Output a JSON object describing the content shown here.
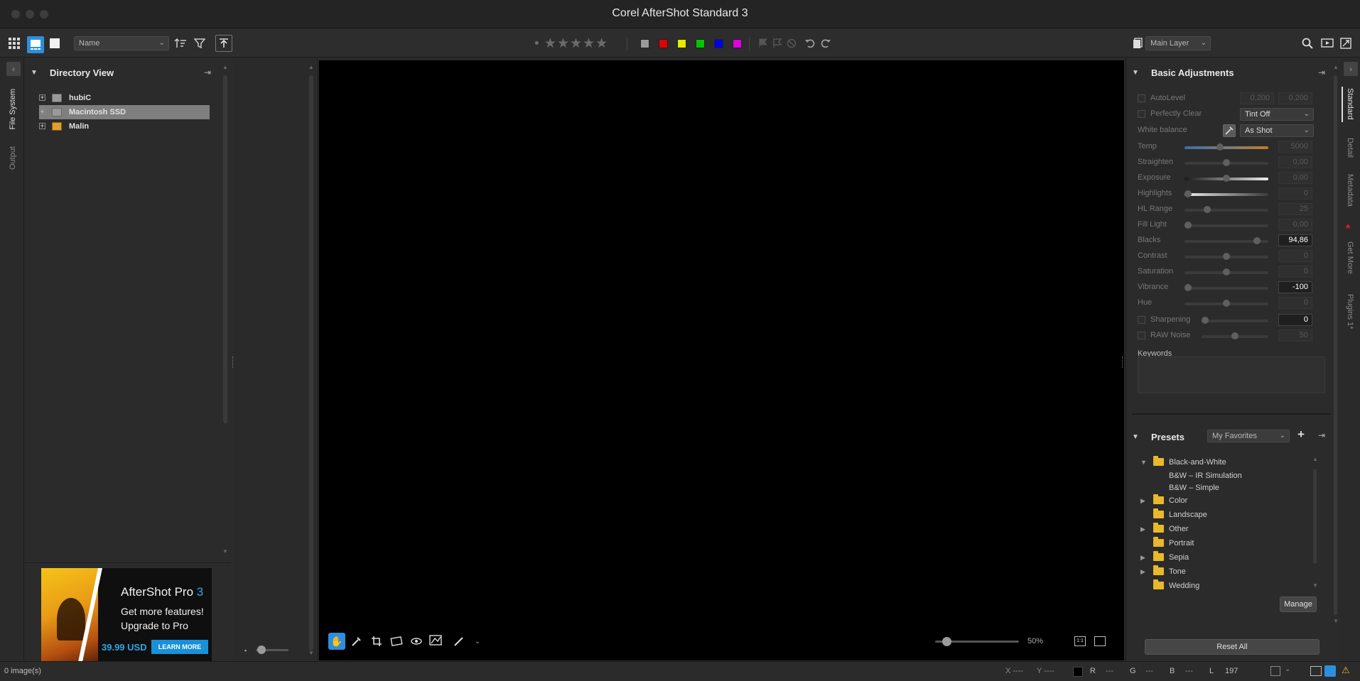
{
  "window": {
    "title": "Corel AfterShot Standard 3"
  },
  "toolbar": {
    "sort_select": "Name",
    "stars": "• ★★★★★",
    "colors": [
      "#9a9a9a",
      "#e00000",
      "#e8e800",
      "#00c800",
      "#0000e0",
      "#e000e0"
    ],
    "layer_select": "Main Layer"
  },
  "left_tabs": {
    "file_system": "File System",
    "output": "Output"
  },
  "directory": {
    "title": "Directory View",
    "items": [
      {
        "label": "hubiC"
      },
      {
        "label": "Macintosh SSD"
      },
      {
        "label": "Malin"
      }
    ]
  },
  "ad": {
    "title_main": "AfterShot Pro ",
    "title_num": "3",
    "line1": "Get more features!",
    "line2": "Upgrade to Pro",
    "price": "39.99 USD",
    "button": "LEARN MORE"
  },
  "viewer": {
    "zoom_label": "50%"
  },
  "adjustments": {
    "title": "Basic Adjustments",
    "autolevel": {
      "label": "AutoLevel",
      "v1": "0,200",
      "v2": "0,200"
    },
    "perfectly_clear": {
      "label": "Perfectly Clear",
      "select": "Tint Off"
    },
    "white_balance": {
      "label": "White balance",
      "select": "As Shot"
    },
    "sliders": [
      {
        "label": "Temp",
        "value": "5000",
        "pos": 0.42
      },
      {
        "label": "Straighten",
        "value": "0,00",
        "pos": 0.5
      },
      {
        "label": "Exposure",
        "value": "0,00",
        "pos": 0.5
      },
      {
        "label": "Highlights",
        "value": "0",
        "pos": 0.0
      },
      {
        "label": "HL Range",
        "value": "25",
        "pos": 0.25
      },
      {
        "label": "Fill Light",
        "value": "0,00",
        "pos": 0.0
      },
      {
        "label": "Blacks",
        "value": "94,86",
        "pos": 0.9
      },
      {
        "label": "Contrast",
        "value": "0",
        "pos": 0.5
      },
      {
        "label": "Saturation",
        "value": "0",
        "pos": 0.5
      },
      {
        "label": "Vibrance",
        "value": "-100",
        "pos": 0.0
      },
      {
        "label": "Hue",
        "value": "0",
        "pos": 0.5
      }
    ],
    "sharpening": {
      "label": "Sharpening",
      "value": "0"
    },
    "raw_noise": {
      "label": "RAW Noise",
      "value": "50"
    },
    "keywords_label": "Keywords"
  },
  "presets": {
    "title": "Presets",
    "select": "My Favorites",
    "items": [
      {
        "label": "Black-and-White",
        "type": "folder",
        "expanded": true
      },
      {
        "label": "B&W – IR Simulation",
        "type": "child"
      },
      {
        "label": "B&W – Simple",
        "type": "child"
      },
      {
        "label": "Color",
        "type": "folder"
      },
      {
        "label": "Landscape",
        "type": "folder-leaf"
      },
      {
        "label": "Other",
        "type": "folder"
      },
      {
        "label": "Portrait",
        "type": "folder-leaf"
      },
      {
        "label": "Sepia",
        "type": "folder"
      },
      {
        "label": "Tone",
        "type": "folder"
      },
      {
        "label": "Wedding",
        "type": "folder-leaf"
      }
    ],
    "manage": "Manage",
    "reset_all": "Reset All"
  },
  "right_tabs": {
    "standard": "Standard",
    "detail": "Detail",
    "metadata": "Metadata",
    "get_more": "Get More",
    "plugins": "Plugins 1*"
  },
  "status": {
    "images": "0 image(s)",
    "x": "X ----",
    "y": "Y ----",
    "r_label": "R",
    "r": "---",
    "g_label": "G",
    "g": "---",
    "b_label": "B",
    "b": "---",
    "l_label": "L",
    "l": "197"
  }
}
